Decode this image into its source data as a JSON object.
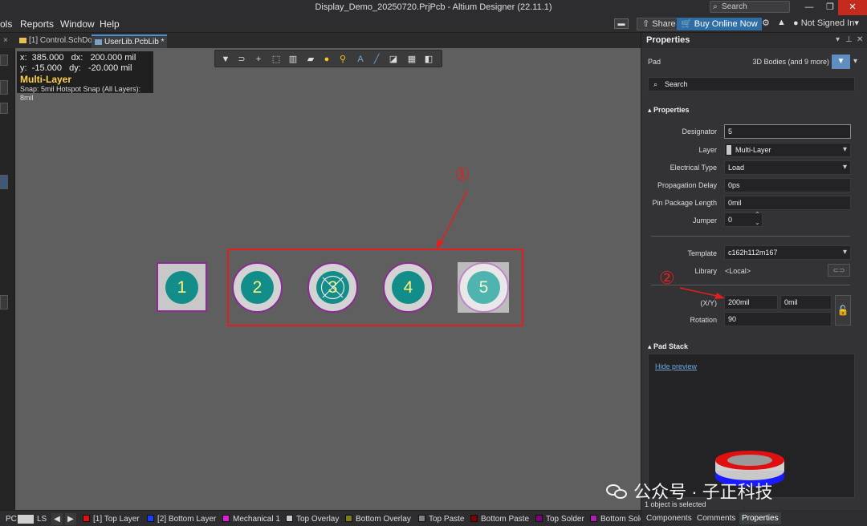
{
  "window": {
    "title": "Display_Demo_20250720.PrjPcb - Altium Designer (22.11.1)",
    "search_placeholder": "Search",
    "minimize": "—",
    "restore": "❐",
    "close": "✕"
  },
  "menu": {
    "items": [
      "ols",
      "Reports",
      "Window",
      "Help"
    ],
    "share": "Share",
    "buy": "Buy Online Now",
    "account": "Not Signed In"
  },
  "tabs": [
    {
      "label": "[1] Control.SchDoc",
      "active": false
    },
    {
      "label": "UserLib.PcbLib *",
      "active": true
    }
  ],
  "hud": {
    "line1": "x:  385.000   dx:   200.000 mil",
    "line2": "y:  -15.000   dy:   -20.000 mil",
    "layer": "Multi-Layer",
    "snap": "Snap: 5mil Hotspot Snap (All Layers): 8mil"
  },
  "pads": [
    "1",
    "2",
    "3",
    "4",
    "5"
  ],
  "annotations": {
    "one": "①",
    "two": "②"
  },
  "layers": [
    {
      "label": "LS",
      "color": ""
    },
    {
      "label": "[1] Top Layer",
      "color": "#e01010"
    },
    {
      "label": "[2] Bottom Layer",
      "color": "#1a3cff"
    },
    {
      "label": "Mechanical 1",
      "color": "#e01bd6"
    },
    {
      "label": "Top Overlay",
      "color": "#c8c8c8"
    },
    {
      "label": "Bottom Overlay",
      "color": "#7d7d1c"
    },
    {
      "label": "Top Paste",
      "color": "#808080"
    },
    {
      "label": "Bottom Paste",
      "color": "#800000"
    },
    {
      "label": "Top Solder",
      "color": "#800080"
    },
    {
      "label": "Bottom Sold",
      "color": "#ad1fad"
    }
  ],
  "layerbar": {
    "pc_label": "PC"
  },
  "properties": {
    "header": "Properties",
    "object_type": "Pad",
    "filter_text": "3D Bodies (and 9 more)",
    "search_placeholder": "Search",
    "section_properties": "Properties",
    "designator_label": "Designator",
    "designator_value": "5",
    "layer_label": "Layer",
    "layer_value": "Multi-Layer",
    "electrical_type_label": "Electrical Type",
    "electrical_type_value": "Load",
    "propagation_delay_label": "Propagation Delay",
    "propagation_delay_value": "0ps",
    "pin_package_length_label": "Pin Package Length",
    "pin_package_length_value": "0mil",
    "jumper_label": "Jumper",
    "jumper_value": "0",
    "template_label": "Template",
    "template_value": "c162h112m167",
    "library_label": "Library",
    "library_value": "<Local>",
    "xy_label": "(X/Y)",
    "x_value": "200mil",
    "y_value": "0mil",
    "rotation_label": "Rotation",
    "rotation_value": "90",
    "section_pad_stack": "Pad Stack",
    "hide_preview": "Hide preview",
    "status": "1 object is selected"
  },
  "bottom_tabs": [
    {
      "label": "Components",
      "active": false
    },
    {
      "label": "Comments",
      "active": false
    },
    {
      "label": "Properties",
      "active": true
    }
  ],
  "watermark": "公众号 · 子正科技"
}
